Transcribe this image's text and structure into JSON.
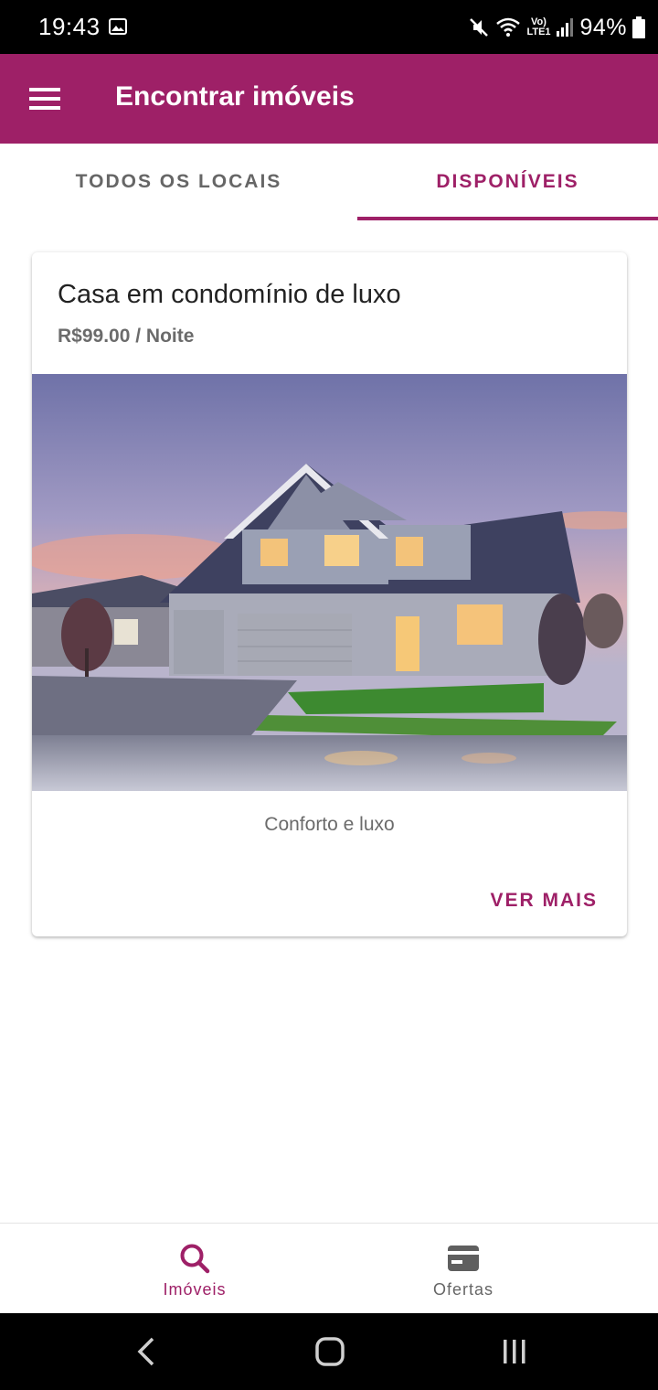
{
  "status_bar": {
    "time": "19:43",
    "network": "Vo) LTE1",
    "battery": "94%",
    "icons": [
      "gallery-icon",
      "mute-icon",
      "wifi-icon",
      "signal-icon",
      "battery-icon"
    ]
  },
  "app_bar": {
    "title": "Encontrar imóveis",
    "menu_icon": "menu-icon"
  },
  "tabs": [
    {
      "label": "TODOS OS LOCAIS",
      "selected": false
    },
    {
      "label": "DISPONÍVEIS",
      "selected": true
    }
  ],
  "listing": {
    "title": "Casa em condomínio de luxo",
    "price": "R$99.00 / Noite",
    "image": "house-photo",
    "description": "Conforto e luxo",
    "action_label": "VER MAIS"
  },
  "bottom_nav": [
    {
      "label": "Imóveis",
      "icon": "search-icon",
      "selected": true
    },
    {
      "label": "Ofertas",
      "icon": "card-icon",
      "selected": false
    }
  ],
  "system_nav": [
    "back-icon",
    "home-icon",
    "recents-icon"
  ],
  "colors": {
    "primary": "#9e2067",
    "status_bar": "#000000",
    "text_secondary": "#6b6b6b"
  }
}
